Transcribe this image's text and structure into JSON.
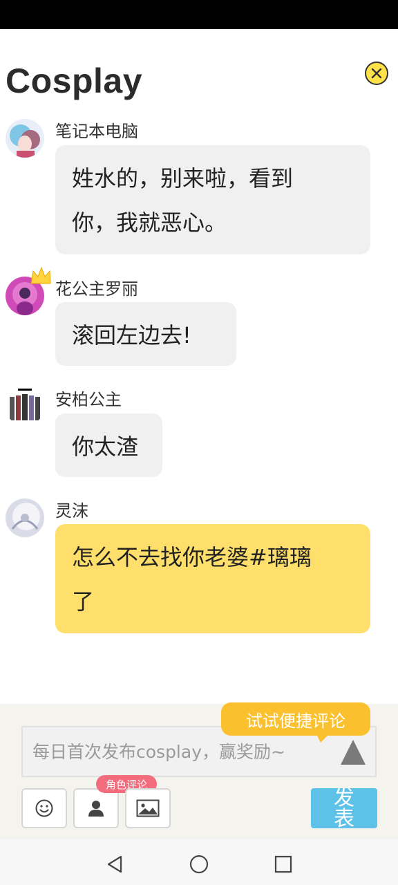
{
  "page": {
    "title": "Cosplay"
  },
  "messages": [
    {
      "user": "笔记本电脑",
      "text_lines": [
        "姓水的，别来啦，看到",
        "你，我就恶心。"
      ],
      "bubble_color": "#f0f0f0",
      "avatar": "avatar-anime-blue-hair"
    },
    {
      "user": "花公主罗丽",
      "text_lines": [
        "滚回左边去!"
      ],
      "bubble_color": "#f0f0f0",
      "avatar": "avatar-anime-pink",
      "crown_icon": "crown-icon"
    },
    {
      "user": "安柏公主",
      "text_lines": [
        "你太渣"
      ],
      "bubble_color": "#f0f0f0",
      "avatar": "avatar-group-characters"
    },
    {
      "user": "灵沫",
      "text_lines": [
        "怎么不去找你老婆#璃璃",
        "了"
      ],
      "bubble_color": "#ffdf6b",
      "avatar": "avatar-white-feathers"
    }
  ],
  "composer": {
    "tooltip": "试试便捷评论",
    "placeholder": "每日首次发布cosplay，赢奖励~",
    "role_badge": "角色评论",
    "publish_label": "发表",
    "icons": [
      "emoji-icon",
      "person-icon",
      "image-icon",
      "send-arrow-icon"
    ]
  },
  "colors": {
    "accent_yellow": "#ffdf6b",
    "tooltip_orange": "#fbc02d",
    "publish_blue": "#5ec2e8",
    "badge_pink": "#f36c7e"
  }
}
